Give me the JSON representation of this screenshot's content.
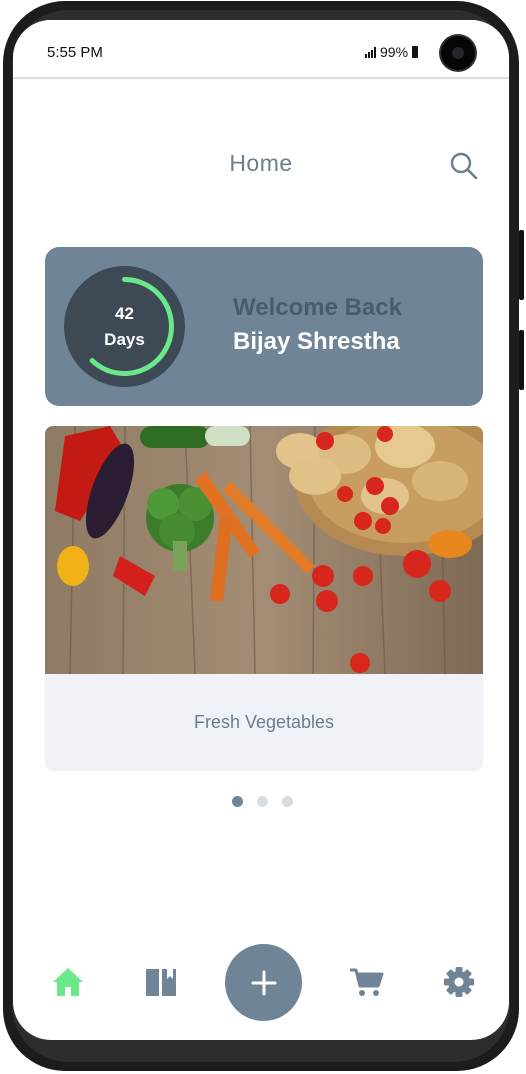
{
  "status_bar": {
    "time": "5:55 PM",
    "battery": "99%"
  },
  "header": {
    "title": "Home",
    "search_icon": "search-icon"
  },
  "welcome_card": {
    "progress_number": "42",
    "progress_unit": "Days",
    "progress_fraction": 0.62,
    "greeting": "Welcome Back",
    "user_name": "Bijay Shrestha"
  },
  "carousel": {
    "items": [
      {
        "caption": "Fresh Vegetables"
      }
    ],
    "page_count": 3,
    "active_index": 0
  },
  "bottom_nav": {
    "items": [
      {
        "icon": "home-icon",
        "active": true
      },
      {
        "icon": "book-icon",
        "active": false
      },
      {
        "icon": "plus-icon",
        "active": false
      },
      {
        "icon": "cart-icon",
        "active": false
      },
      {
        "icon": "gear-icon",
        "active": false
      }
    ]
  },
  "colors": {
    "accent": "#6f8597",
    "active_green": "#6be889",
    "ring_bg": "#3d4a55",
    "icon_gray": "#6f8597"
  }
}
